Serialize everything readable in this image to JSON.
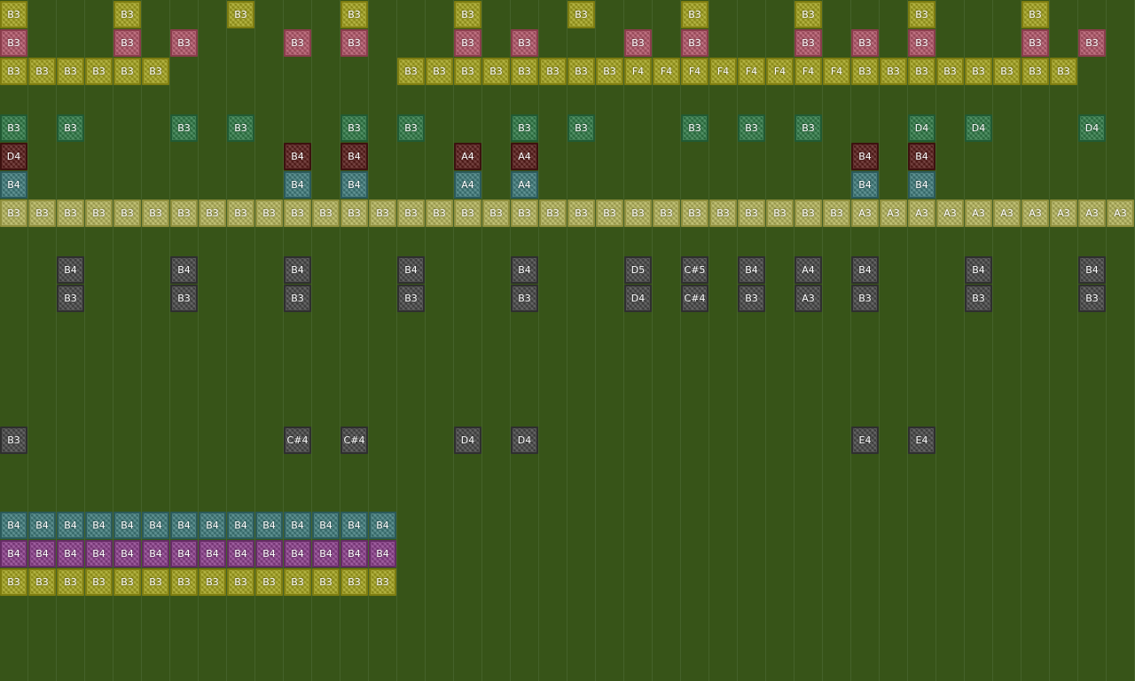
{
  "palette": {
    "background": "#375418",
    "yellow": "#a5a41d",
    "pink": "#b35669",
    "green": "#2f7b47",
    "maroon": "#5a1d1a",
    "teal": "#3f7c7c",
    "lightyellow": "#b5b55b",
    "gray": "#474747",
    "purple": "#8c3f8c"
  },
  "rows": [
    {
      "row": 0,
      "color": "yellow",
      "notes": [
        [
          0,
          "B3"
        ],
        [
          4,
          "B3"
        ],
        [
          8,
          "B3"
        ],
        [
          12,
          "B3"
        ],
        [
          16,
          "B3"
        ],
        [
          20,
          "B3"
        ],
        [
          24,
          "B3"
        ],
        [
          28,
          "B3"
        ],
        [
          32,
          "B3"
        ],
        [
          36,
          "B3"
        ]
      ]
    },
    {
      "row": 1,
      "color": "pink",
      "notes": [
        [
          0,
          "B3"
        ],
        [
          4,
          "B3"
        ],
        [
          6,
          "B3"
        ],
        [
          10,
          "B3"
        ],
        [
          12,
          "B3"
        ],
        [
          16,
          "B3"
        ],
        [
          18,
          "B3"
        ],
        [
          22,
          "B3"
        ],
        [
          24,
          "B3"
        ],
        [
          28,
          "B3"
        ],
        [
          30,
          "B3"
        ],
        [
          32,
          "B3"
        ],
        [
          36,
          "B3"
        ],
        [
          38,
          "B3"
        ]
      ]
    },
    {
      "row": 2,
      "color": "yellow",
      "notes": [
        [
          0,
          "B3"
        ],
        [
          1,
          "B3"
        ],
        [
          2,
          "B3"
        ],
        [
          3,
          "B3"
        ],
        [
          4,
          "B3"
        ],
        [
          5,
          "B3"
        ],
        [
          14,
          "B3"
        ],
        [
          15,
          "B3"
        ],
        [
          16,
          "B3"
        ],
        [
          17,
          "B3"
        ],
        [
          18,
          "B3"
        ],
        [
          19,
          "B3"
        ],
        [
          20,
          "B3"
        ],
        [
          21,
          "B3"
        ],
        [
          22,
          "F4"
        ],
        [
          23,
          "F4"
        ],
        [
          24,
          "F4"
        ],
        [
          25,
          "F4"
        ],
        [
          26,
          "F4"
        ],
        [
          27,
          "F4"
        ],
        [
          28,
          "F4"
        ],
        [
          29,
          "F4"
        ],
        [
          30,
          "B3"
        ],
        [
          31,
          "B3"
        ],
        [
          32,
          "B3"
        ],
        [
          33,
          "B3"
        ],
        [
          34,
          "B3"
        ],
        [
          35,
          "B3"
        ],
        [
          36,
          "B3"
        ],
        [
          37,
          "B3"
        ]
      ]
    },
    {
      "row": 4,
      "color": "green",
      "notes": [
        [
          0,
          "B3"
        ],
        [
          2,
          "B3"
        ],
        [
          6,
          "B3"
        ],
        [
          8,
          "B3"
        ],
        [
          12,
          "B3"
        ],
        [
          14,
          "B3"
        ],
        [
          18,
          "B3"
        ],
        [
          20,
          "B3"
        ],
        [
          24,
          "B3"
        ],
        [
          26,
          "B3"
        ],
        [
          28,
          "B3"
        ],
        [
          32,
          "D4"
        ],
        [
          34,
          "D4"
        ],
        [
          38,
          "D4"
        ]
      ]
    },
    {
      "row": 5,
      "color": "maroon",
      "notes": [
        [
          0,
          "D4"
        ],
        [
          10,
          "B4"
        ],
        [
          12,
          "B4"
        ],
        [
          16,
          "A4"
        ],
        [
          18,
          "A4"
        ],
        [
          30,
          "B4"
        ],
        [
          32,
          "B4"
        ]
      ]
    },
    {
      "row": 6,
      "color": "teal",
      "notes": [
        [
          0,
          "B4"
        ],
        [
          10,
          "B4"
        ],
        [
          12,
          "B4"
        ],
        [
          16,
          "A4"
        ],
        [
          18,
          "A4"
        ],
        [
          30,
          "B4"
        ],
        [
          32,
          "B4"
        ]
      ]
    },
    {
      "row": 7,
      "color": "lightyellow",
      "notes": [
        [
          0,
          "B3"
        ],
        [
          1,
          "B3"
        ],
        [
          2,
          "B3"
        ],
        [
          3,
          "B3"
        ],
        [
          4,
          "B3"
        ],
        [
          5,
          "B3"
        ],
        [
          6,
          "B3"
        ],
        [
          7,
          "B3"
        ],
        [
          8,
          "B3"
        ],
        [
          9,
          "B3"
        ],
        [
          10,
          "B3"
        ],
        [
          11,
          "B3"
        ],
        [
          12,
          "B3"
        ],
        [
          13,
          "B3"
        ],
        [
          14,
          "B3"
        ],
        [
          15,
          "B3"
        ],
        [
          16,
          "B3"
        ],
        [
          17,
          "B3"
        ],
        [
          18,
          "B3"
        ],
        [
          19,
          "B3"
        ],
        [
          20,
          "B3"
        ],
        [
          21,
          "B3"
        ],
        [
          22,
          "B3"
        ],
        [
          23,
          "B3"
        ],
        [
          24,
          "B3"
        ],
        [
          25,
          "B3"
        ],
        [
          26,
          "B3"
        ],
        [
          27,
          "B3"
        ],
        [
          28,
          "B3"
        ],
        [
          29,
          "B3"
        ],
        [
          30,
          "A3"
        ],
        [
          31,
          "A3"
        ],
        [
          32,
          "A3"
        ],
        [
          33,
          "A3"
        ],
        [
          34,
          "A3"
        ],
        [
          35,
          "A3"
        ],
        [
          36,
          "A3"
        ],
        [
          37,
          "A3"
        ],
        [
          38,
          "A3"
        ],
        [
          39,
          "A3"
        ]
      ]
    },
    {
      "row": 9,
      "color": "gray",
      "notes": [
        [
          2,
          "B4"
        ],
        [
          6,
          "B4"
        ],
        [
          10,
          "B4"
        ],
        [
          14,
          "B4"
        ],
        [
          18,
          "B4"
        ],
        [
          22,
          "D5"
        ],
        [
          24,
          "C#5"
        ],
        [
          26,
          "B4"
        ],
        [
          28,
          "A4"
        ],
        [
          30,
          "B4"
        ],
        [
          34,
          "B4"
        ],
        [
          38,
          "B4"
        ]
      ]
    },
    {
      "row": 10,
      "color": "gray",
      "notes": [
        [
          2,
          "B3"
        ],
        [
          6,
          "B3"
        ],
        [
          10,
          "B3"
        ],
        [
          14,
          "B3"
        ],
        [
          18,
          "B3"
        ],
        [
          22,
          "D4"
        ],
        [
          24,
          "C#4"
        ],
        [
          26,
          "B3"
        ],
        [
          28,
          "A3"
        ],
        [
          30,
          "B3"
        ],
        [
          34,
          "B3"
        ],
        [
          38,
          "B3"
        ]
      ]
    },
    {
      "row": 15,
      "color": "gray",
      "notes": [
        [
          0,
          "B3"
        ],
        [
          10,
          "C#4"
        ],
        [
          12,
          "C#4"
        ],
        [
          16,
          "D4"
        ],
        [
          18,
          "D4"
        ],
        [
          30,
          "E4"
        ],
        [
          32,
          "E4"
        ]
      ]
    },
    {
      "row": 18,
      "color": "teal",
      "notes": [
        [
          0,
          "B4"
        ],
        [
          1,
          "B4"
        ],
        [
          2,
          "B4"
        ],
        [
          3,
          "B4"
        ],
        [
          4,
          "B4"
        ],
        [
          5,
          "B4"
        ],
        [
          6,
          "B4"
        ],
        [
          7,
          "B4"
        ],
        [
          8,
          "B4"
        ],
        [
          9,
          "B4"
        ],
        [
          10,
          "B4"
        ],
        [
          11,
          "B4"
        ],
        [
          12,
          "B4"
        ],
        [
          13,
          "B4"
        ]
      ]
    },
    {
      "row": 19,
      "color": "purple",
      "notes": [
        [
          0,
          "B4"
        ],
        [
          1,
          "B4"
        ],
        [
          2,
          "B4"
        ],
        [
          3,
          "B4"
        ],
        [
          4,
          "B4"
        ],
        [
          5,
          "B4"
        ],
        [
          6,
          "B4"
        ],
        [
          7,
          "B4"
        ],
        [
          8,
          "B4"
        ],
        [
          9,
          "B4"
        ],
        [
          10,
          "B4"
        ],
        [
          11,
          "B4"
        ],
        [
          12,
          "B4"
        ],
        [
          13,
          "B4"
        ]
      ]
    },
    {
      "row": 20,
      "color": "yellow",
      "notes": [
        [
          0,
          "B3"
        ],
        [
          1,
          "B3"
        ],
        [
          2,
          "B3"
        ],
        [
          3,
          "B3"
        ],
        [
          4,
          "B3"
        ],
        [
          5,
          "B3"
        ],
        [
          6,
          "B3"
        ],
        [
          7,
          "B3"
        ],
        [
          8,
          "B3"
        ],
        [
          9,
          "B3"
        ],
        [
          10,
          "B3"
        ],
        [
          11,
          "B3"
        ],
        [
          12,
          "B3"
        ],
        [
          13,
          "B3"
        ]
      ]
    }
  ]
}
